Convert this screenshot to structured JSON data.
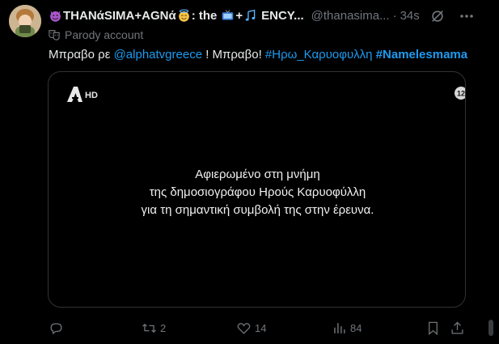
{
  "post": {
    "author": {
      "display_name": "THANάSIMA+AGNά",
      "display_name_suffix": ": the",
      "display_name_tail": "ENCY...",
      "handle": "@thanasima...",
      "avatar_icon": "avatar-image"
    },
    "separator": "·",
    "time": "34s",
    "parody_label": "Parody account",
    "text": {
      "prefix": "Μπραβο ρε ",
      "mention": "@alphatvgreece",
      "middle": " ! Μπραβο! ",
      "hashtag1": "#Ηρω_Καρυοφυλλη",
      "space": " ",
      "hashtag2": "#Namelesmama"
    },
    "media": {
      "channel_logo_text": "HD",
      "rating": "12",
      "caption_line1": "Αφιερωμένο στη μνήμη",
      "caption_line2": "της δημοσιογράφου Ηρούς Καρυοφύλλη",
      "caption_line3": "για τη σημαντική συμβολή της στην έρευνα."
    },
    "actions": {
      "reply_count": "",
      "repost_count": "2",
      "like_count": "14",
      "views_count": "84"
    }
  },
  "colors": {
    "background": "#000000",
    "text": "#e7e9ea",
    "muted": "#71767b",
    "accent": "#1d9bf0",
    "border": "#2f3336"
  }
}
